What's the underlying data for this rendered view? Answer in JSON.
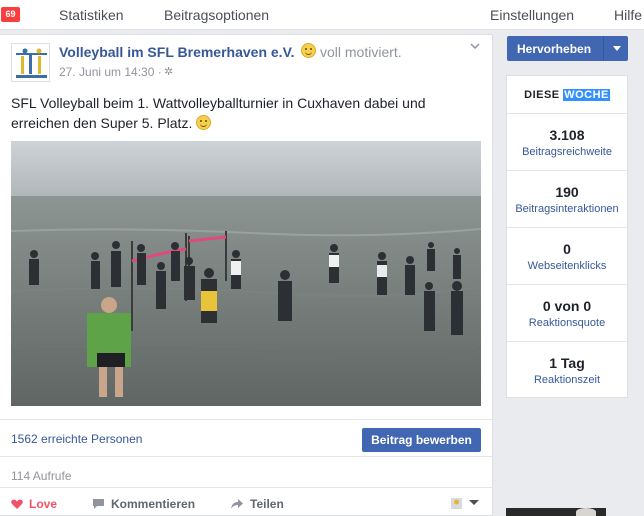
{
  "notifications": {
    "count": "69"
  },
  "topnav": {
    "items": [
      "Statistiken",
      "Beitragsoptionen",
      "Einstellungen",
      "Hilfe"
    ]
  },
  "post": {
    "page_name": "Volleyball im SFL Bremerhaven e.V.",
    "feeling": "voll motiviert.",
    "date": "27. Juni um 14:30 ·",
    "text": "SFL Volleyball beim 1. Wattvolleyballturnier in Cuxhaven dabei und erreichen den Super 5. Platz.",
    "reach": "1562 erreichte Personen",
    "promote_label": "Beitrag bewerben",
    "views": "114 Aufrufe",
    "actions": {
      "love": "Love",
      "comment": "Kommentieren",
      "share": "Teilen"
    }
  },
  "sidebar": {
    "boost_label": "Hervorheben",
    "stats_title_a": "DIESE",
    "stats_title_b": "WOCHE",
    "stats": [
      {
        "value": "3.108",
        "label": "Beitragsreichweite"
      },
      {
        "value": "190",
        "label": "Beitragsinteraktionen"
      },
      {
        "value": "0",
        "label": "Webseitenklicks"
      },
      {
        "value": "0 von 0",
        "label": "Reaktionsquote"
      },
      {
        "value": "1 Tag",
        "label": "Reaktionszeit"
      }
    ]
  },
  "colors": {
    "brand_blue": "#4267b2",
    "link_blue": "#365899",
    "badge_red": "#fa3e3e",
    "love_red": "#f25268"
  },
  "icons": [
    "globe-icon",
    "chevron-down-icon",
    "heart-icon",
    "comment-icon",
    "share-icon",
    "smiley-icon"
  ]
}
